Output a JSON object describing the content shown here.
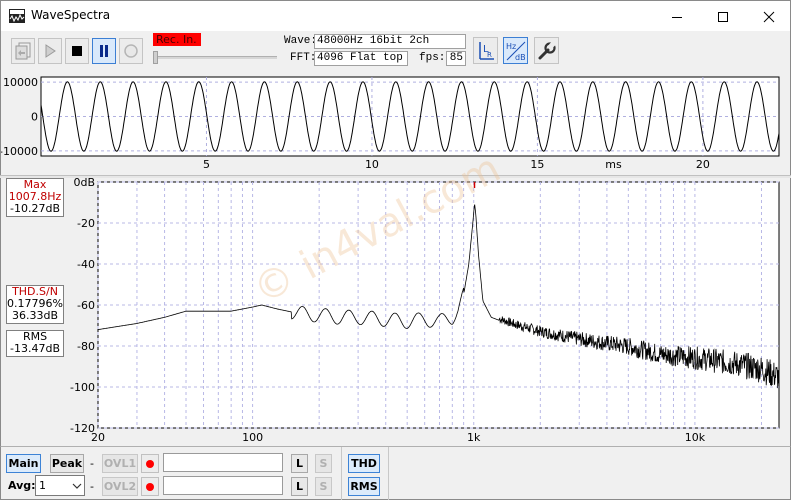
{
  "window": {
    "title": "WaveSpectra",
    "app_icon": "wavespectra-app-icon",
    "controls": [
      "minimize-icon",
      "maximize-icon",
      "close-icon"
    ]
  },
  "toolbar": {
    "buttons": [
      {
        "name": "import-wave-button",
        "icon": "import-icon"
      },
      {
        "name": "play-button",
        "icon": "play-icon"
      },
      {
        "name": "stop-button",
        "icon": "stop-icon"
      },
      {
        "name": "pause-button",
        "icon": "pause-icon",
        "active": true
      },
      {
        "name": "record-button",
        "icon": "record-icon"
      }
    ],
    "rec_indicator": "Rec. In.",
    "wave_label": "Wave:",
    "wave_value": "48000Hz 16bit 2ch",
    "fft_label": "FFT:",
    "fft_value": "4096 Flat top",
    "fps_label": "fps:",
    "fps_value": "85",
    "channel_button": {
      "icon": "lr-channel-icon",
      "text": "L",
      "sub": "R"
    },
    "scale_button": {
      "icon": "hz-db-scale-icon",
      "top": "Hz",
      "bottom": "dB"
    },
    "settings_button": {
      "icon": "wrench-icon"
    }
  },
  "waveform": {
    "y_ticks": [
      "10000",
      "0",
      "-10000"
    ],
    "x_ticks": [
      "5",
      "10",
      "15",
      "20"
    ],
    "x_unit": "ms"
  },
  "spectrum": {
    "max_label": "Max",
    "max_freq": "1007.8Hz",
    "max_level": "-10.27dB",
    "thd_label": "THD.S/N",
    "thd_value": "0.17796%",
    "sn_value": "36.33dB",
    "rms_label": "RMS",
    "rms_value": "-13.47dB",
    "y_ticks": [
      "0dB",
      "-20",
      "-40",
      "-60",
      "-80",
      "-100",
      "-120"
    ],
    "x_ticks": [
      "20",
      "100",
      "1k",
      "10k"
    ],
    "watermark": "© in4val.com"
  },
  "chart_data": [
    {
      "type": "line",
      "title": "",
      "xlabel": "ms",
      "ylabel": "",
      "xlim": [
        0,
        22.3
      ],
      "ylim": [
        -11500,
        11500
      ],
      "x_ticks": [
        5,
        10,
        15,
        20
      ],
      "y_ticks": [
        10000,
        0,
        -10000
      ],
      "grid": true,
      "series": [
        {
          "frequency_hz": 1007.8,
          "amplitude": 10100,
          "x_start_ms": 0,
          "x_end_ms": 22.3
        }
      ]
    },
    {
      "type": "line",
      "title": "",
      "xlabel": "",
      "ylabel": "",
      "x_scale": "log",
      "xlim": [
        20,
        24000
      ],
      "ylim": [
        -120,
        0
      ],
      "x_ticks": [
        "20",
        "100",
        "1k",
        "10k"
      ],
      "y_ticks": [
        0,
        -20,
        -40,
        -60,
        -80,
        -100,
        -120
      ],
      "grid": true,
      "series": [
        {
          "x": [
            20,
            30,
            40,
            50,
            60,
            80,
            100,
            110,
            130,
            160,
            200,
            250,
            300,
            400,
            500,
            600,
            700,
            800,
            850,
            900,
            950,
            980,
            1000,
            1007.8,
            1020,
            1050,
            1100,
            1200,
            1500,
            2000,
            3000,
            5000,
            7000,
            10000,
            15000,
            20000,
            24000
          ],
          "y": [
            -72,
            -69,
            -66,
            -63,
            -63,
            -63,
            -61,
            -60,
            -62,
            -64,
            -65,
            -66,
            -66,
            -67,
            -68,
            -67,
            -68,
            -66,
            -62,
            -55,
            -40,
            -25,
            -15,
            -10.27,
            -15,
            -35,
            -58,
            -66,
            -70,
            -74,
            -78,
            -82,
            -86,
            -88,
            -91,
            -94,
            -98
          ]
        }
      ]
    }
  ],
  "bottom": {
    "main_button": "Main",
    "peak_button": "Peak",
    "dash1": "-",
    "dash2": "-",
    "ovl1_button": "OVL1",
    "ovl2_button": "OVL2",
    "avg_label": "Avg:",
    "avg_value": "1",
    "l1_button": "L",
    "s1_button": "S",
    "l2_button": "L",
    "s2_button": "S",
    "thd_button": "THD",
    "rms_button": "RMS"
  }
}
